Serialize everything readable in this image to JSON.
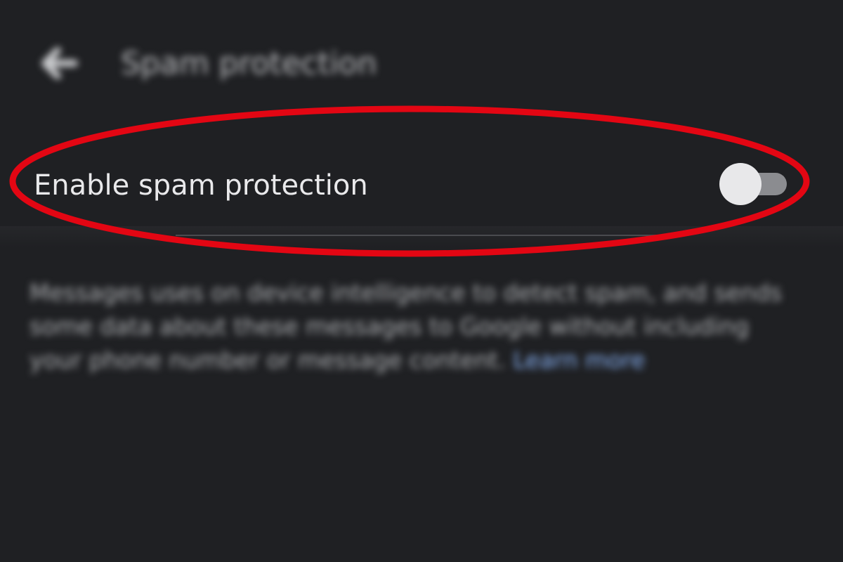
{
  "header": {
    "title": "Spam protection",
    "back_icon": "arrow-back-icon"
  },
  "setting": {
    "label": "Enable spam protection",
    "toggle_on": false
  },
  "description": {
    "text": "Messages uses on device intelligence to detect spam, and sends some data about these messages to Google without including your phone number or message content.",
    "link": "Learn more"
  },
  "colors": {
    "background": "#1f2023",
    "highlight": "#e30613",
    "link": "#8ab4f8",
    "toggle_thumb": "#e8e8ea",
    "toggle_track": "#8b8c90"
  }
}
